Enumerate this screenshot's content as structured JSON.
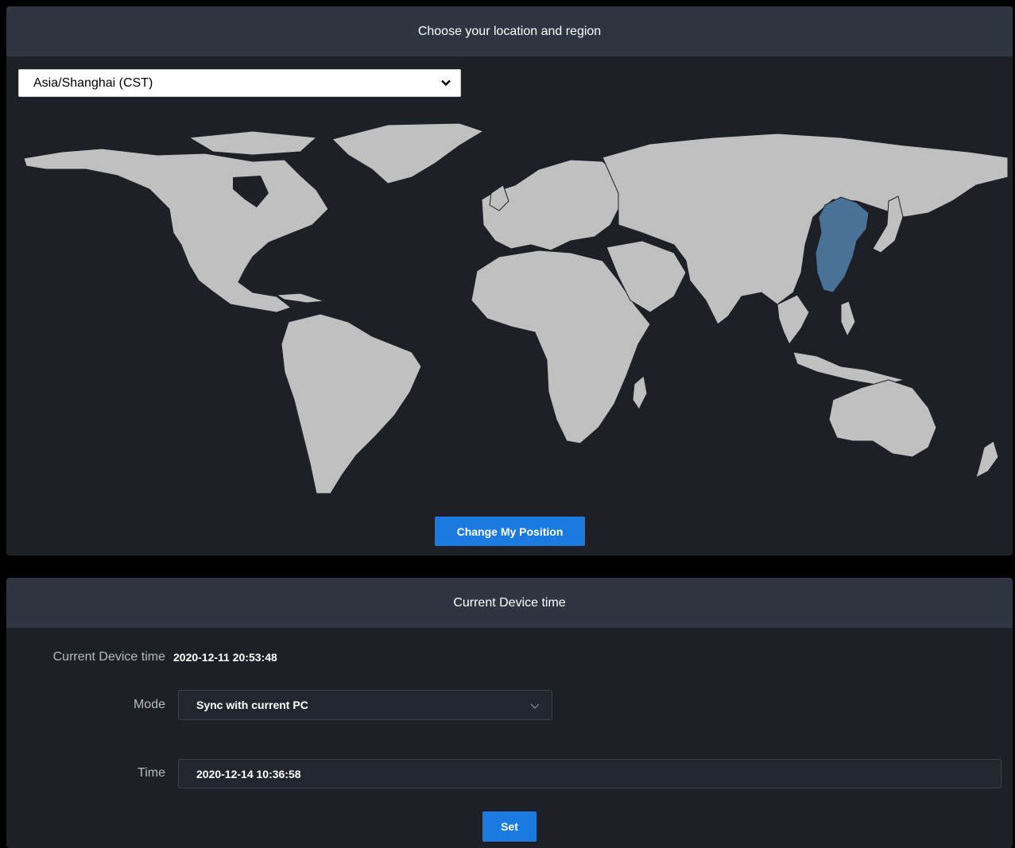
{
  "location_panel": {
    "title": "Choose your location and region",
    "timezone_selected": "Asia/Shanghai (CST)",
    "change_button": "Change My Position",
    "highlighted_region": "China",
    "colors": {
      "land": "#c0c0c0",
      "highlight": "#4a7196",
      "background": "#1e2027"
    }
  },
  "time_panel": {
    "title": "Current Device time",
    "current_label": "Current Device time",
    "current_value": "2020-12-11 20:53:48",
    "mode_label": "Mode",
    "mode_value": "Sync with current PC",
    "time_label": "Time",
    "time_value": "2020-12-14 10:36:58",
    "set_button": "Set"
  },
  "icons": {
    "dropdown": "chevron-down-icon"
  },
  "colors": {
    "accent": "#1b7ae0",
    "header": "#2f3541",
    "panel": "#1e2027"
  }
}
